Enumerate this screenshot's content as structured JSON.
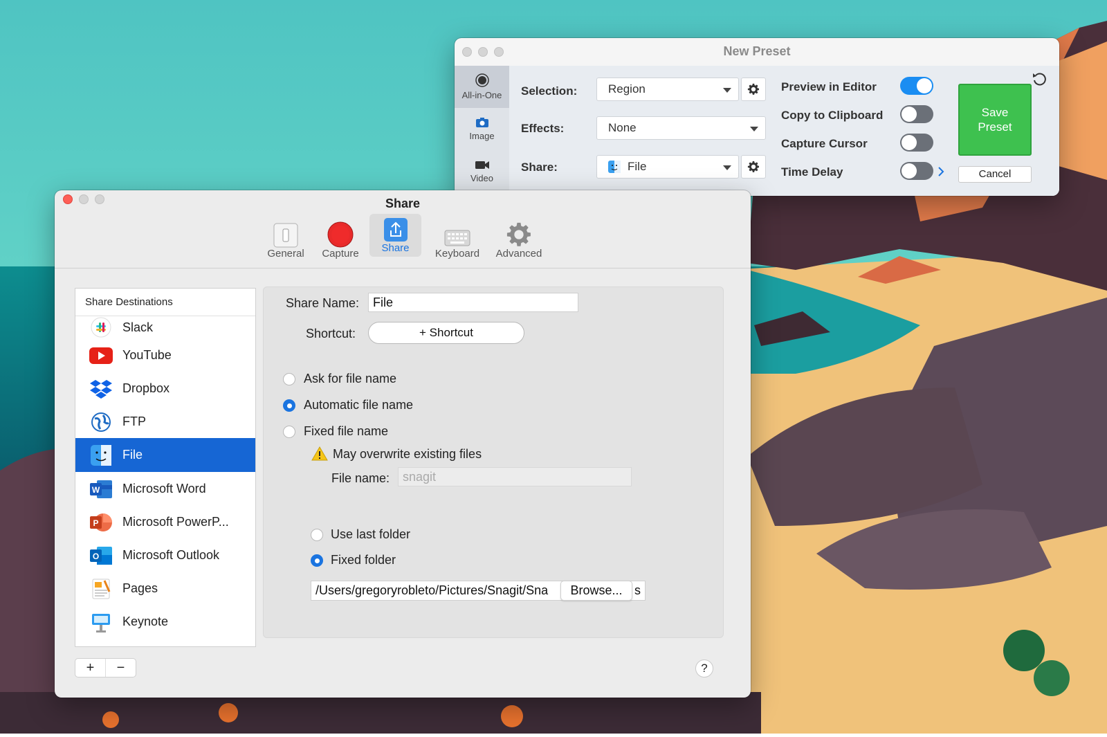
{
  "preset_window": {
    "title": "New Preset",
    "modes": [
      {
        "label": "All-in-One"
      },
      {
        "label": "Image"
      },
      {
        "label": "Video"
      }
    ],
    "selection_label": "Selection:",
    "selection_value": "Region",
    "effects_label": "Effects:",
    "effects_value": "None",
    "share_label": "Share:",
    "share_value": "File",
    "toggles": [
      {
        "label": "Preview in Editor",
        "on": true
      },
      {
        "label": "Copy to Clipboard",
        "on": false
      },
      {
        "label": "Capture Cursor",
        "on": false
      },
      {
        "label": "Time Delay",
        "on": false
      }
    ],
    "save_label_line1": "Save",
    "save_label_line2": "Preset",
    "cancel_label": "Cancel"
  },
  "share_window": {
    "title": "Share",
    "toolbar": [
      {
        "label": "General"
      },
      {
        "label": "Capture"
      },
      {
        "label": "Share"
      },
      {
        "label": "Keyboard"
      },
      {
        "label": "Advanced"
      }
    ],
    "list_header": "Share Destinations",
    "destinations": [
      {
        "label": "Slack"
      },
      {
        "label": "YouTube"
      },
      {
        "label": "Dropbox"
      },
      {
        "label": "FTP"
      },
      {
        "label": "File",
        "selected": true
      },
      {
        "label": "Microsoft Word"
      },
      {
        "label": "Microsoft PowerP..."
      },
      {
        "label": "Microsoft Outlook"
      },
      {
        "label": "Pages"
      },
      {
        "label": "Keynote"
      }
    ],
    "share_name_label": "Share Name:",
    "share_name_value": "File",
    "shortcut_label": "Shortcut:",
    "shortcut_button": "+ Shortcut",
    "naming_options": [
      {
        "label": "Ask for file name",
        "selected": false
      },
      {
        "label": "Automatic file name",
        "selected": true
      },
      {
        "label": "Fixed file name",
        "selected": false
      }
    ],
    "warning": "May overwrite existing files",
    "file_name_label": "File name:",
    "file_name_placeholder": "snagit",
    "folder_options": [
      {
        "label": "Use last folder",
        "selected": false
      },
      {
        "label": "Fixed folder",
        "selected": true
      }
    ],
    "folder_path": "/Users/gregoryrobleto/Pictures/Snagit/Sna",
    "folder_path_tail": "s",
    "browse_label": "Browse...",
    "add_label": "+",
    "remove_label": "−",
    "help_label": "?"
  },
  "colors": {
    "accent_blue": "#1a74e0",
    "selection_blue": "#1666d4",
    "save_green": "#3ec14f",
    "toggle_on": "#1a8df2"
  }
}
